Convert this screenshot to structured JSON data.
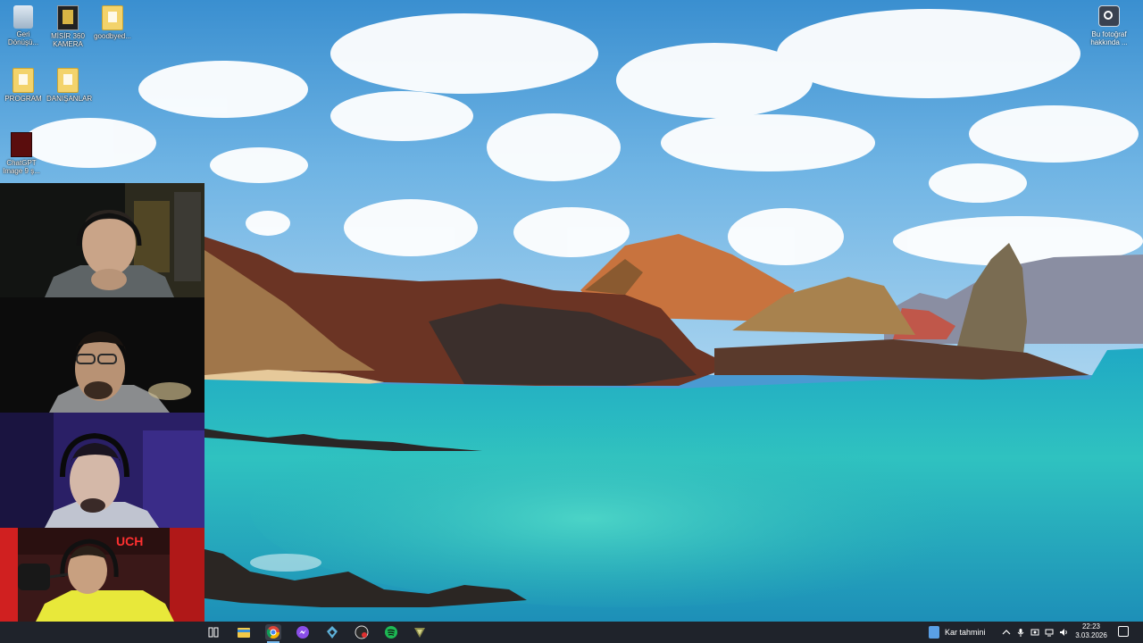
{
  "desktop": {
    "icons": [
      {
        "label": "Geri Dönüşü...",
        "icon": "recycle-bin-icon"
      },
      {
        "label": "MİSİR 360 KAMERA",
        "icon": "folder-dark-icon"
      },
      {
        "label": "goodbyed...",
        "icon": "folder-icon"
      },
      {
        "label": "PROGRAM",
        "icon": "folder-icon"
      },
      {
        "label": "DANIŞANLAR",
        "icon": "folder-icon"
      },
      {
        "label": "ChatGPT Image 9 ş...",
        "icon": "image-file-icon"
      }
    ],
    "top_right_icon": {
      "label": "Bu fotoğraf hakkında ...",
      "icon": "camera-lens-icon"
    }
  },
  "webcams": [
    {
      "name": "participant-1"
    },
    {
      "name": "participant-2"
    },
    {
      "name": "participant-3"
    },
    {
      "name": "participant-4",
      "sign_text": "UCH"
    }
  ],
  "taskbar": {
    "pinned": [
      {
        "icon": "task-view-icon"
      },
      {
        "icon": "file-explorer-icon"
      },
      {
        "icon": "chrome-icon",
        "active": true
      },
      {
        "icon": "messenger-icon"
      },
      {
        "icon": "vpn-icon"
      },
      {
        "icon": "recorder-icon"
      },
      {
        "icon": "spotify-icon"
      },
      {
        "icon": "app-icon"
      }
    ],
    "weather_label": "Kar tahmini",
    "clock": {
      "time": "22:23",
      "date": "3.03.2026"
    }
  },
  "colors": {
    "taskbar": "#1f232b",
    "sky": "#4a9ad2",
    "sea": "#2bb8b6",
    "active_accent": "#76b9ed"
  }
}
